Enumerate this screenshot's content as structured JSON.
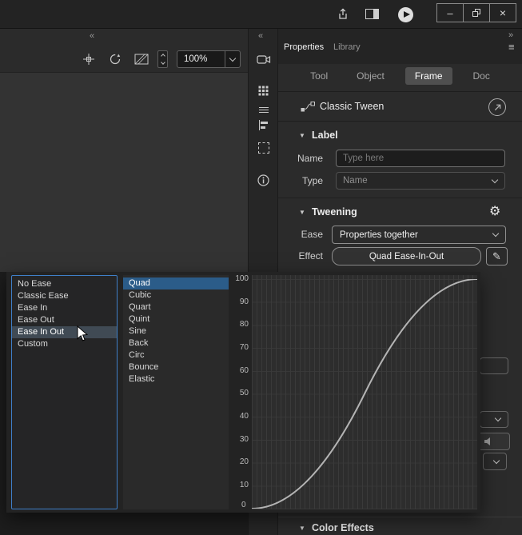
{
  "icons": {
    "minimize": "–",
    "close": "×",
    "menu": "≡",
    "collapse_left": "«",
    "collapse_right": "»",
    "gear": "⚙",
    "pencil": "✎",
    "section_chevron": "▼"
  },
  "stage": {
    "zoom_value": "100%"
  },
  "properties_panel": {
    "tabs": [
      {
        "label": "Properties"
      },
      {
        "label": "Library"
      }
    ],
    "active_tab": "Properties",
    "subtabs": [
      "Tool",
      "Object",
      "Frame",
      "Doc"
    ],
    "selected_subtab": "Frame",
    "tween_row": {
      "label": "Classic Tween"
    },
    "label_section": {
      "title": "Label",
      "name_label": "Name",
      "name_placeholder": "Type here",
      "type_label": "Type",
      "type_value": "Name"
    },
    "tweening_section": {
      "title": "Tweening",
      "ease_label": "Ease",
      "ease_value": "Properties together",
      "effect_label": "Effect",
      "effect_value": "Quad Ease-In-Out"
    },
    "color_effects_section": {
      "title": "Color Effects"
    }
  },
  "ease_popup": {
    "categories": [
      "No Ease",
      "Classic Ease",
      "Ease In",
      "Ease Out",
      "Ease In Out",
      "Custom"
    ],
    "selected_category": "Ease In Out",
    "types": [
      "Quad",
      "Cubic",
      "Quart",
      "Quint",
      "Sine",
      "Back",
      "Circ",
      "Bounce",
      "Elastic"
    ],
    "selected_type": "Quad",
    "graph": {
      "type": "line",
      "curve": "quad-ease-in-out",
      "y_ticks": [
        "100",
        "90",
        "80",
        "70",
        "60",
        "50",
        "40",
        "30",
        "20",
        "10"
      ],
      "origin_label": "0",
      "y_range": [
        0,
        100
      ]
    }
  }
}
